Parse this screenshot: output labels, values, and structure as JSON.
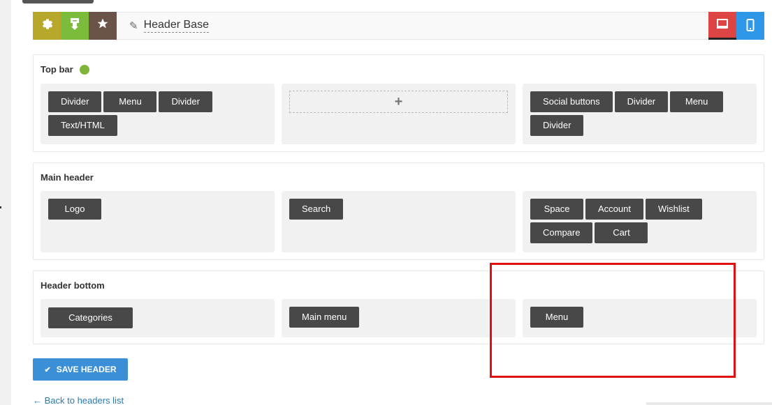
{
  "header": {
    "title": "Header Base",
    "buttons": [
      {
        "icon": "gear-icon",
        "color": "#b7a72b"
      },
      {
        "icon": "import-icon",
        "color": "#7cbc3c"
      },
      {
        "icon": "star-icon",
        "color": "#6b5447"
      }
    ],
    "devices": [
      {
        "icon": "desktop-icon",
        "color": "#dd4444",
        "active": true
      },
      {
        "icon": "mobile-icon",
        "color": "#2e97e8",
        "active": false
      }
    ]
  },
  "sections": {
    "top_bar": {
      "title": "Top bar",
      "status_color": "#7fb53a",
      "left": [
        "Divider",
        "Menu",
        "Divider",
        "Text/HTML"
      ],
      "center_add": "+",
      "right": [
        "Social buttons",
        "Divider",
        "Menu",
        "Divider"
      ]
    },
    "main_header": {
      "title": "Main header",
      "left": [
        "Logo"
      ],
      "center": [
        "Search"
      ],
      "right": [
        "Space",
        "Account",
        "Wishlist",
        "Compare",
        "Cart"
      ]
    },
    "header_bottom": {
      "title": "Header bottom",
      "left": [
        "Categories"
      ],
      "center": [
        "Main menu"
      ],
      "right": [
        "Menu"
      ]
    }
  },
  "actions": {
    "save_label": "SAVE HEADER",
    "back_label": "← Back to headers list"
  },
  "colors": {
    "element_bg": "#484848",
    "save_bg": "#3b8fd7",
    "highlight": "#e01010"
  }
}
